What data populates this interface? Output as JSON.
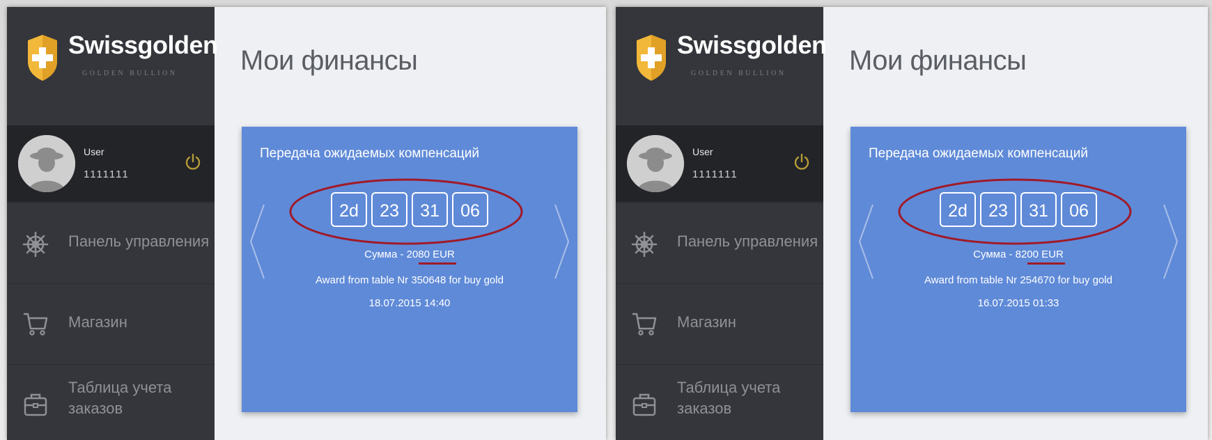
{
  "panels": [
    {
      "brand": {
        "name": "Swissgolden",
        "tagline": "GOLDEN BULLION"
      },
      "user": {
        "label": "User",
        "id": "1111111"
      },
      "nav": [
        {
          "label": "Панель управления",
          "icon": "ship-wheel-icon"
        },
        {
          "label": "Магазин",
          "icon": "cart-icon"
        },
        {
          "label": "Таблица учета заказов",
          "icon": "briefcase-icon"
        }
      ],
      "page_title": "Мои финансы",
      "card": {
        "title": "Передача ожидаемых компенсаций",
        "countdown": [
          "2d",
          "23",
          "31",
          "06"
        ],
        "amount_prefix": "Сумма - ",
        "amount": "2080 EUR",
        "award": "Award from table Nr 350648 for buy gold",
        "date": "18.07.2015 14:40"
      }
    },
    {
      "brand": {
        "name": "Swissgolden",
        "tagline": "GOLDEN BULLION"
      },
      "user": {
        "label": "User",
        "id": "1111111"
      },
      "nav": [
        {
          "label": "Панель управления",
          "icon": "ship-wheel-icon"
        },
        {
          "label": "Магазин",
          "icon": "cart-icon"
        },
        {
          "label": "Таблица учета заказов",
          "icon": "briefcase-icon"
        }
      ],
      "page_title": "Мои финансы",
      "card": {
        "title": "Передача ожидаемых компенсаций",
        "countdown": [
          "2d",
          "23",
          "31",
          "06"
        ],
        "amount_prefix": "Сумма - ",
        "amount": "8200 EUR",
        "award": "Award from table Nr 254670 for buy gold",
        "date": "16.07.2015 01:33"
      }
    }
  ],
  "colors": {
    "sidebar": "#34363b",
    "user_row": "#232428",
    "card": "#5f8ad8",
    "shield_gold": "#f2b83a",
    "annotation_red": "#a01a28",
    "power_icon": "#b59b38"
  }
}
